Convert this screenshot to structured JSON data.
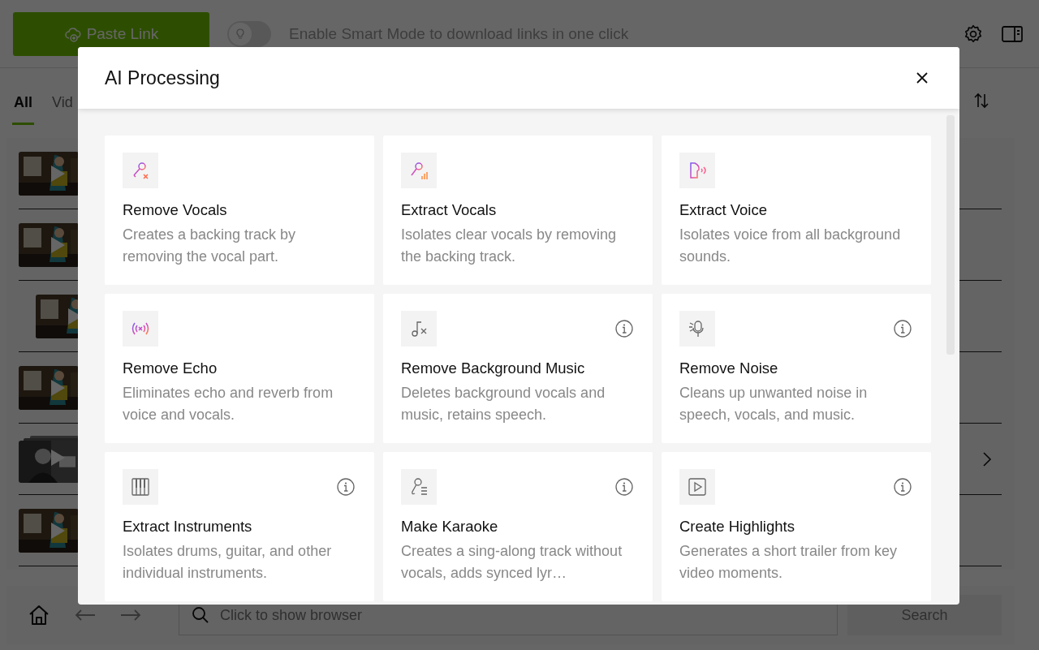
{
  "toolbar": {
    "paste_button": "Paste Link",
    "smart_mode": {
      "on": false,
      "label": "Enable Smart Mode to download links in one click"
    }
  },
  "tabs": [
    {
      "label": "All",
      "selected": true
    },
    {
      "label": "Vid",
      "selected": false
    }
  ],
  "library": {
    "rows": [
      {
        "kind": "video",
        "expandable": false
      },
      {
        "kind": "video",
        "expandable": false
      },
      {
        "kind": "clip",
        "expandable": false
      },
      {
        "kind": "video",
        "expandable": false
      },
      {
        "kind": "playlist",
        "expandable": true
      },
      {
        "kind": "video",
        "expandable": false
      }
    ]
  },
  "browser_bar": {
    "placeholder": "Click to show browser",
    "search_button": "Search"
  },
  "dialog": {
    "title": "AI Processing",
    "cards": [
      {
        "title": "Remove Vocals",
        "description": "Creates a backing track by removing the vocal part.",
        "info": false
      },
      {
        "title": "Extract Vocals",
        "description": "Isolates clear vocals by removing the backing track.",
        "info": false
      },
      {
        "title": "Extract Voice",
        "description": "Isolates voice from all background sounds.",
        "info": false
      },
      {
        "title": "Remove Echo",
        "description": "Eliminates echo and reverb from voice and vocals.",
        "info": false
      },
      {
        "title": "Remove Background Music",
        "description": "Deletes background vocals and music, retains speech.",
        "info": true
      },
      {
        "title": "Remove Noise",
        "description": "Cleans up unwanted noise in speech, vocals, and music.",
        "info": true
      },
      {
        "title": "Extract Instruments",
        "description": "Isolates drums, guitar, and other individual instruments.",
        "info": true
      },
      {
        "title": "Make Karaoke",
        "description": "Creates a sing-along track without vocals, adds synced lyr…",
        "info": true
      },
      {
        "title": "Create Highlights",
        "description": "Generates a short trailer from key video moments.",
        "info": true
      }
    ]
  }
}
